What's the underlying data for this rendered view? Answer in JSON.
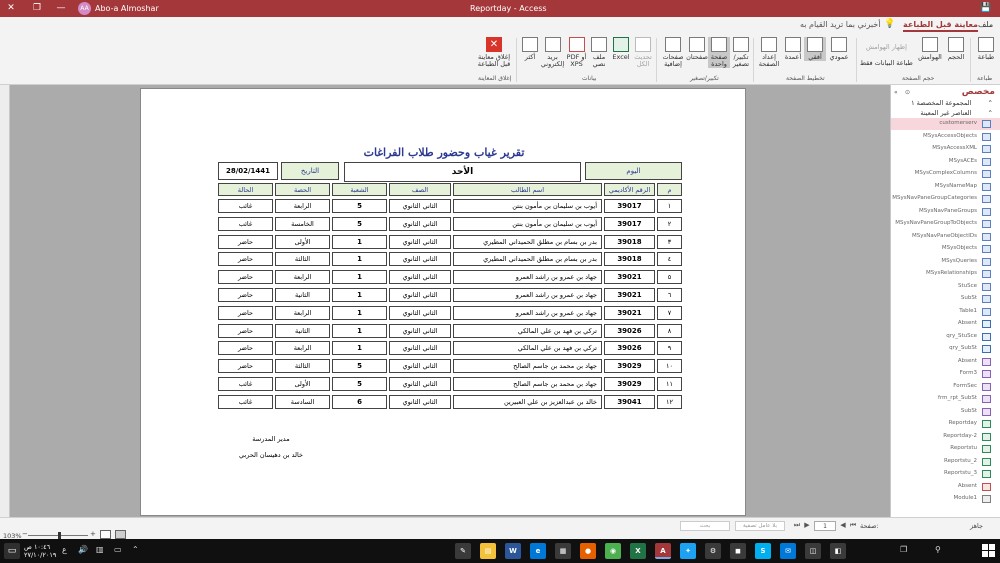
{
  "titlebar": {
    "title": "Reportday  -  Access",
    "user": "Abo-a Almoshar",
    "user_initials": "AA",
    "buttons": {
      "close": "✕",
      "restore": "❐",
      "minimize": "—",
      "ribbon_opts": "▭"
    },
    "qa_save": "💾"
  },
  "ribbon_tabs": {
    "file": "ملف",
    "print_preview": "معاينة قبل الطباعة",
    "tell_me": "أخبرني بما تريد القيام به"
  },
  "ribbon": {
    "print": "طباعة",
    "size": "الحجم",
    "margins": "الهوامش",
    "print_data_only": "طباعة البيانات فقط",
    "show_margins": "إظهار الهوامش",
    "portrait": "عمودي",
    "landscape": "أفقي",
    "columns": "أعمدة",
    "page_setup": "إعداد الصفحة",
    "zoom": "تكبير/ تصغير",
    "one_page": "صفحة واحدة",
    "two_pages": "صفحتان",
    "more_pages": "صفحات إضافية",
    "refresh_all": "تحديث الكل",
    "excel": "Excel",
    "text_file": "ملف نصي",
    "pdf_xps": "PDF أو XPS",
    "email": "بريد إلكتروني",
    "more": "أكثر",
    "close_preview": "إغلاق معاينة قبل الطباعة",
    "groups": {
      "print": "طباعة",
      "page_size": "حجم الصفحة",
      "page_layout": "تخطيط الصفحة",
      "zoom": "تكبير/تصغير",
      "data": "بيانات",
      "close_preview": "إغلاق المعاينة"
    }
  },
  "report": {
    "title": "تقرير غياب وحضور طلاب الفراغات",
    "day_label": "اليوم",
    "day_value": "الأحد",
    "date_label": "التاريخ",
    "date_value": "28/02/1441",
    "columns": [
      "م",
      "الرقم الأكاديمي",
      "اسم الطالب",
      "الصف",
      "الشعبة",
      "الحصة",
      "الحالة"
    ],
    "rows": [
      {
        "num": "١",
        "id": "39017",
        "name": "أيوب بن سليمان بن مأمون بنتن",
        "class": "الثاني الثانوي",
        "section": "5",
        "period": "الرابعة",
        "status": "غائب"
      },
      {
        "num": "٢",
        "id": "39017",
        "name": "أيوب بن سليمان بن مأمون بنتن",
        "class": "الثاني الثانوي",
        "section": "5",
        "period": "الخامسة",
        "status": "غائب"
      },
      {
        "num": "٣",
        "id": "39018",
        "name": "بدر بن بسام بن مطلق الحميداني المطيري",
        "class": "الثاني الثانوي",
        "section": "1",
        "period": "الأولى",
        "status": "حاضر"
      },
      {
        "num": "٤",
        "id": "39018",
        "name": "بدر بن بسام بن مطلق الحميداني المطيري",
        "class": "الثاني الثانوي",
        "section": "1",
        "period": "الثالثة",
        "status": "حاضر"
      },
      {
        "num": "٥",
        "id": "39021",
        "name": "جهاد بن عمرو بن راشد العمرو",
        "class": "الثاني الثانوي",
        "section": "1",
        "period": "الرابعة",
        "status": "حاضر"
      },
      {
        "num": "٦",
        "id": "39021",
        "name": "جهاد بن عمرو بن راشد العمرو",
        "class": "الثاني الثانوي",
        "section": "1",
        "period": "الثانية",
        "status": "حاضر"
      },
      {
        "num": "٧",
        "id": "39021",
        "name": "جهاد بن عمرو بن راشد العمرو",
        "class": "الثاني الثانوي",
        "section": "1",
        "period": "الرابعة",
        "status": "حاضر"
      },
      {
        "num": "٨",
        "id": "39026",
        "name": "تركي بن فهد بن علي المالكي",
        "class": "الثاني الثانوي",
        "section": "1",
        "period": "الثانية",
        "status": "حاضر"
      },
      {
        "num": "٩",
        "id": "39026",
        "name": "تركي بن فهد بن علي المالكي",
        "class": "الثاني الثانوي",
        "section": "1",
        "period": "الرابعة",
        "status": "حاضر"
      },
      {
        "num": "١٠",
        "id": "39029",
        "name": "جهاد بن محمد بن جاسم الصالح",
        "class": "الثاني الثانوي",
        "section": "5",
        "period": "الثالثة",
        "status": "حاضر"
      },
      {
        "num": "١١",
        "id": "39029",
        "name": "جهاد بن محمد بن جاسم الصالح",
        "class": "الثاني الثانوي",
        "section": "5",
        "period": "الأولى",
        "status": "غائب"
      },
      {
        "num": "١٢",
        "id": "39041",
        "name": "خالد بن عبدالعزيز بن علي العبيرين",
        "class": "الثاني الثانوي",
        "section": "6",
        "period": "السادسة",
        "status": "غائب"
      }
    ],
    "principal_title": "مدير المدرسة",
    "principal_name": "خالد بن دهيسان الحربي"
  },
  "nav": {
    "title": "مخصص",
    "group1": "المجموعة المخصصة ١",
    "group2": "العناصر غير المعينة",
    "items": [
      {
        "label": "customerserv",
        "type": "table",
        "selected": true
      },
      {
        "label": "MSysAccessObjects",
        "type": "table"
      },
      {
        "label": "MSysAccessXML",
        "type": "table"
      },
      {
        "label": "MSysACEs",
        "type": "table"
      },
      {
        "label": "MSysComplexColumns",
        "type": "table"
      },
      {
        "label": "MSysNameMap",
        "type": "table"
      },
      {
        "label": "MSysNavPaneGroupCategories",
        "type": "table"
      },
      {
        "label": "MSysNavPaneGroups",
        "type": "table"
      },
      {
        "label": "MSysNavPaneGroupToObjects",
        "type": "table"
      },
      {
        "label": "MSysNavPaneObjectIDs",
        "type": "table"
      },
      {
        "label": "MSysObjects",
        "type": "table"
      },
      {
        "label": "MSysQueries",
        "type": "table"
      },
      {
        "label": "MSysRelationships",
        "type": "table"
      },
      {
        "label": "StuSce",
        "type": "table"
      },
      {
        "label": "SubSt",
        "type": "table"
      },
      {
        "label": "Table1",
        "type": "table"
      },
      {
        "label": "Absent",
        "type": "query"
      },
      {
        "label": "qry_StuSce",
        "type": "query"
      },
      {
        "label": "qry_SubSt",
        "type": "query"
      },
      {
        "label": "Absent",
        "type": "form"
      },
      {
        "label": "Form3",
        "type": "form"
      },
      {
        "label": "FormSec",
        "type": "form"
      },
      {
        "label": "frm_rpt_SubSt",
        "type": "form"
      },
      {
        "label": "SubSt",
        "type": "form"
      },
      {
        "label": "Reportday",
        "type": "report"
      },
      {
        "label": "Reportday-2",
        "type": "report"
      },
      {
        "label": "Reportstu",
        "type": "report"
      },
      {
        "label": "Reportstu_2",
        "type": "report"
      },
      {
        "label": "Reportstu_3",
        "type": "report"
      },
      {
        "label": "Absent",
        "type": "macro"
      },
      {
        "label": "Module1",
        "type": "module"
      }
    ]
  },
  "statusbar": {
    "ready": "جاهز",
    "page_label": "صفحة:",
    "page_value": "1",
    "first": "⏮",
    "prev": "◀",
    "next": "▶",
    "last": "⏭",
    "no_filter": "بلا عامل تصفية",
    "search_placeholder": "بحث",
    "zoom": "103%",
    "zoom_minus": "−",
    "zoom_plus": "+"
  },
  "taskbar": {
    "time": "١٠:٤٦ ص",
    "date": "٢٧/١٠/٢٠١٩",
    "lang": "ع",
    "apps": [
      {
        "name": "Notepad",
        "color": "#3a3a3a",
        "glyph": "✎"
      },
      {
        "name": "Files",
        "color": "#f3c13a",
        "glyph": "▤"
      },
      {
        "name": "Word",
        "color": "#2b579a",
        "glyph": "W"
      },
      {
        "name": "Edge",
        "color": "#0078d7",
        "glyph": "e"
      },
      {
        "name": "Explorer",
        "color": "#3a3a3a",
        "glyph": "▦"
      },
      {
        "name": "Firefox",
        "color": "#e66000",
        "glyph": "●"
      },
      {
        "name": "Chrome",
        "color": "#4caf50",
        "glyph": "◉"
      },
      {
        "name": "Excel",
        "color": "#217346",
        "glyph": "X"
      },
      {
        "name": "Access",
        "color": "#a4373a",
        "glyph": "A",
        "active": true
      },
      {
        "name": "Twitter",
        "color": "#1da1f2",
        "glyph": "✦"
      },
      {
        "name": "Settings",
        "color": "#3a3a3a",
        "glyph": "⚙"
      },
      {
        "name": "Store",
        "color": "#3a3a3a",
        "glyph": "◼"
      },
      {
        "name": "Skype",
        "color": "#00aff0",
        "glyph": "S"
      },
      {
        "name": "Mail",
        "color": "#0078d7",
        "glyph": "✉"
      },
      {
        "name": "Photos",
        "color": "#3a3a3a",
        "glyph": "◫"
      },
      {
        "name": "Weather",
        "color": "#3a3a3a",
        "glyph": "◧"
      }
    ]
  }
}
